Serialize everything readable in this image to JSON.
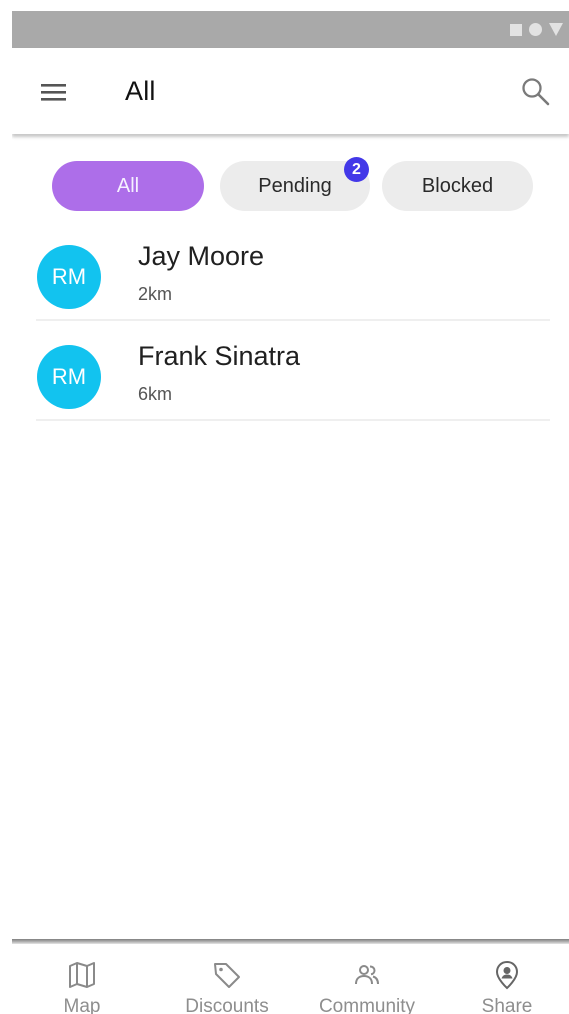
{
  "status_bar": {
    "icons": [
      "status-square-icon",
      "status-circle-icon",
      "status-triangle-icon"
    ]
  },
  "app_bar": {
    "title": "All",
    "menu_icon": "menu-icon",
    "search_icon": "search-icon"
  },
  "filters": {
    "all": "All",
    "pending": "Pending",
    "pending_badge": "2",
    "blocked": "Blocked",
    "active": "All",
    "active_color": "#ad6ee9",
    "badge_color": "#4338e8"
  },
  "list": {
    "items": [
      {
        "avatar": "RM",
        "name": "Jay Moore",
        "distance": "2km"
      },
      {
        "avatar": "RM",
        "name": "Frank Sinatra",
        "distance": "6km"
      }
    ],
    "avatar_color": "#12c3ef"
  },
  "bottom_nav": {
    "items": [
      {
        "label": "Map",
        "icon": "map-icon"
      },
      {
        "label": "Discounts",
        "icon": "tag-icon"
      },
      {
        "label": "Community",
        "icon": "community-icon"
      },
      {
        "label": "Share",
        "icon": "share-location-icon"
      }
    ]
  }
}
